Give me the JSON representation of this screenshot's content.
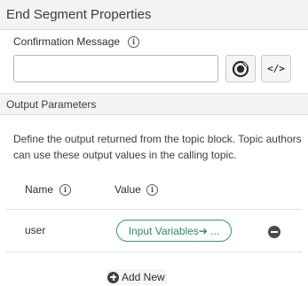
{
  "panel": {
    "title": "End Segment Properties"
  },
  "confirmation": {
    "label": "Confirmation Message",
    "info_icon": "i",
    "value": "",
    "placeholder": ""
  },
  "output_section": {
    "title": "Output Parameters",
    "description": "Define the output returned from the topic block. Topic authors can use these output values in the calling topic.",
    "columns": {
      "name": "Name",
      "value": "Value",
      "info_icon": "i"
    },
    "rows": [
      {
        "name": "user",
        "value_pill": "Input Variables➔ ..."
      }
    ],
    "add_new_label": "Add New"
  },
  "icons": {
    "data_pill_picker": "data-pill-icon",
    "script_editor": "code-icon",
    "remove": "minus-circle-icon",
    "add": "plus-circle-icon",
    "info": "info-icon"
  },
  "colors": {
    "pill_border": "#2a9d6e",
    "pill_text": "#2a8a63"
  }
}
